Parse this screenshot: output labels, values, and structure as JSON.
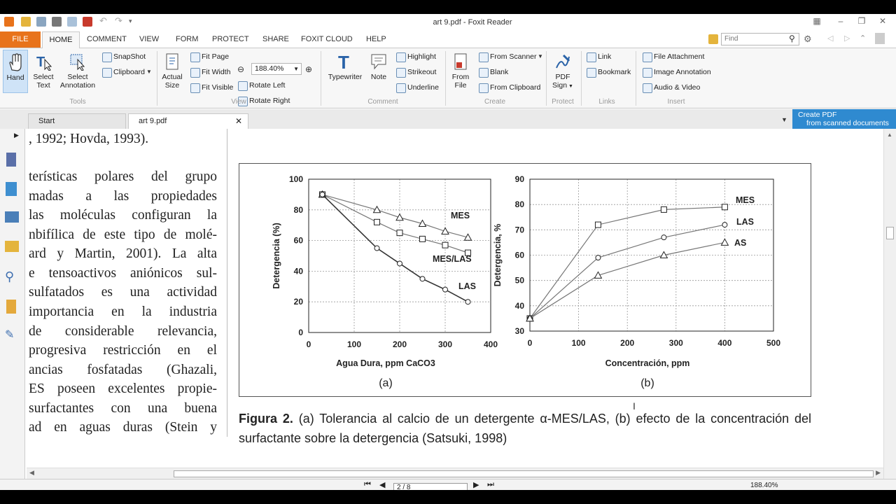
{
  "window": {
    "title": "art 9.pdf - Foxit Reader"
  },
  "ribbon_tabs": [
    {
      "label": "FILE"
    },
    {
      "label": "HOME"
    },
    {
      "label": "COMMENT"
    },
    {
      "label": "VIEW"
    },
    {
      "label": "FORM"
    },
    {
      "label": "PROTECT"
    },
    {
      "label": "SHARE"
    },
    {
      "label": "FOXIT CLOUD"
    },
    {
      "label": "HELP"
    }
  ],
  "search": {
    "placeholder": "Find"
  },
  "ribbon": {
    "tools": {
      "hand": "Hand",
      "select_text_1": "Select",
      "select_text_2": "Text",
      "select_ann_1": "Select",
      "select_ann_2": "Annotation",
      "snapshot": "SnapShot",
      "clipboard": "Clipboard",
      "group": "Tools"
    },
    "view": {
      "actual_1": "Actual",
      "actual_2": "Size",
      "fit_page": "Fit Page",
      "fit_width": "Fit Width",
      "fit_visible": "Fit Visible",
      "zoom": "188.40%",
      "rotate_left": "Rotate Left",
      "rotate_right": "Rotate Right",
      "group": "View"
    },
    "comment": {
      "typewriter": "Typewriter",
      "note": "Note",
      "highlight": "Highlight",
      "strikeout": "Strikeout",
      "underline": "Underline",
      "group": "Comment"
    },
    "create": {
      "from_file_1": "From",
      "from_file_2": "File",
      "from_scanner": "From Scanner",
      "blank": "Blank",
      "from_clipboard": "From Clipboard",
      "group": "Create"
    },
    "protect": {
      "pdf_sign_1": "PDF",
      "pdf_sign_2": "Sign",
      "group": "Protect"
    },
    "links": {
      "link": "Link",
      "bookmark": "Bookmark",
      "group": "Links"
    },
    "insert": {
      "file_attachment": "File Attachment",
      "image_annotation": "Image Annotation",
      "audio_video": "Audio & Video",
      "group": "Insert"
    }
  },
  "doc_tabs": [
    {
      "label": "Start"
    },
    {
      "label": "art 9.pdf"
    }
  ],
  "banner": {
    "line1": "Create PDF",
    "line2": "from scanned documents"
  },
  "document": {
    "left_column": [
      ", 1992; Hovda, 1993).",
      "terísticas polares del grupo",
      "madas a las propiedades",
      "las moléculas configuran la",
      "nbifílica de este tipo de molé-",
      "ard y Martin, 2001). La alta",
      "e tensoactivos aniónicos sul-",
      "sulfatados es una actividad",
      "importancia en la industria",
      "de considerable relevancia,",
      "progresiva restricción en el",
      "ancias fosfatadas (Ghazali,",
      "ES poseen excelentes propie-",
      "surfactantes con una buena",
      "ad en aguas duras (Stein y"
    ],
    "caption_bold": "Figura 2.",
    "caption_text": " (a) Tolerancia al calcio de un detergente α-MES/LAS, (b) efecto de la concentración del surfactante sobre la detergencia (Satsuki, 1998)"
  },
  "chart_data": [
    {
      "type": "line",
      "panel_label": "(a)",
      "xlabel": "Agua Dura, ppm  CaCO3",
      "ylabel": "Detergencia (%)",
      "xlim": [
        0,
        400
      ],
      "ylim": [
        0,
        100
      ],
      "xticks": [
        0,
        100,
        200,
        300,
        400
      ],
      "yticks": [
        0,
        20,
        40,
        60,
        80,
        100
      ],
      "grid": true,
      "series": [
        {
          "name": "MES",
          "marker": "triangle",
          "x": [
            30,
            150,
            200,
            250,
            300,
            350
          ],
          "y": [
            90,
            80,
            75,
            71,
            66,
            62
          ]
        },
        {
          "name": "MES/LAS",
          "marker": "square",
          "x": [
            30,
            150,
            200,
            250,
            300,
            350
          ],
          "y": [
            90,
            72,
            65,
            61,
            57,
            52
          ]
        },
        {
          "name": "LAS",
          "marker": "circle",
          "x": [
            30,
            150,
            200,
            250,
            300,
            350
          ],
          "y": [
            90,
            55,
            45,
            35,
            28,
            20
          ]
        }
      ]
    },
    {
      "type": "line",
      "panel_label": "(b)",
      "xlabel": "Concentración, ppm",
      "ylabel": "Detergencia, %",
      "xlim": [
        0,
        500
      ],
      "ylim": [
        30,
        90
      ],
      "xticks": [
        0,
        100,
        200,
        300,
        400,
        500
      ],
      "yticks": [
        30,
        40,
        50,
        60,
        70,
        80,
        90
      ],
      "grid": true,
      "series": [
        {
          "name": "MES",
          "marker": "square",
          "x": [
            0,
            140,
            275,
            400
          ],
          "y": [
            35,
            72,
            78,
            79
          ]
        },
        {
          "name": "LAS",
          "marker": "circle",
          "x": [
            0,
            140,
            275,
            400
          ],
          "y": [
            35,
            59,
            67,
            72
          ]
        },
        {
          "name": "AS",
          "marker": "triangle",
          "x": [
            0,
            140,
            275,
            400
          ],
          "y": [
            35,
            52,
            60,
            65
          ]
        }
      ]
    }
  ],
  "statusbar": {
    "page": "2 / 8",
    "zoom": "188.40%"
  }
}
